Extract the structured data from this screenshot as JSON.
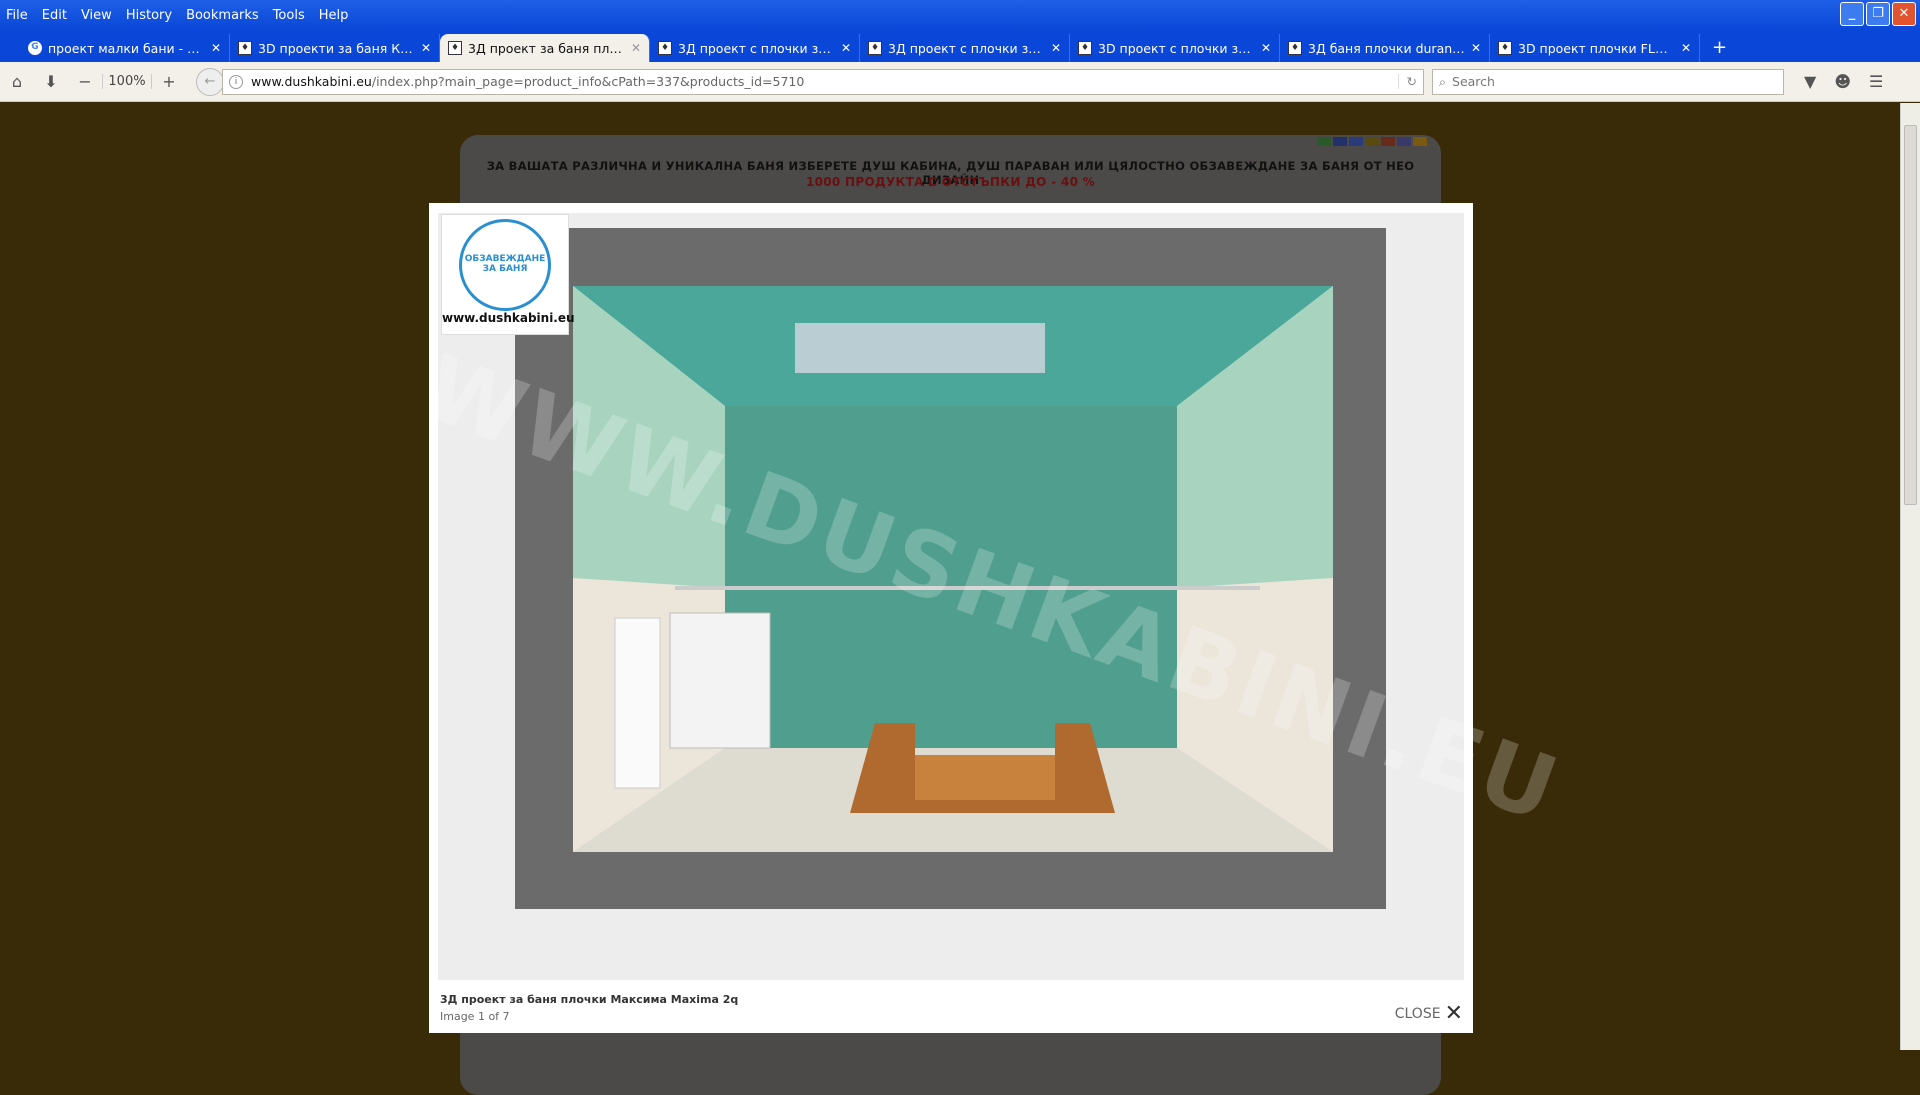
{
  "menu": [
    "File",
    "Edit",
    "View",
    "History",
    "Bookmarks",
    "Tools",
    "Help"
  ],
  "tabs": [
    {
      "label": "проект малки бани - Go...",
      "icon": "google-icon"
    },
    {
      "label": "3D проекти за баня КА...",
      "icon": "site-favicon"
    },
    {
      "label": "3Д проект за баня плоч...",
      "icon": "site-favicon",
      "active": true
    },
    {
      "label": "3Д проект с плочки за ...",
      "icon": "site-favicon"
    },
    {
      "label": "3Д проект с плочки за ...",
      "icon": "site-favicon"
    },
    {
      "label": "3D проект с плочки за ...",
      "icon": "site-favicon"
    },
    {
      "label": "3Д баня плочки durang...",
      "icon": "site-favicon"
    },
    {
      "label": "3D проект плочки FLAM...",
      "icon": "site-favicon"
    }
  ],
  "toolbar": {
    "zoom": "100%",
    "url_domain": "www.dushkabini.eu",
    "url_path": "/index.php?main_page=product_info&cPath=337&products_id=5710",
    "search_placeholder": "Search"
  },
  "page": {
    "slogan": "ЗА ВАШАТА РАЗЛИЧНА И УНИКАЛНА БАНЯ ИЗБЕРЕТЕ ДУШ КАБИНА, ДУШ ПАРАВАН ИЛИ ЦЯЛОСТНО ОБЗАВЕЖДАНЕ ЗА БАНЯ ОТ НЕО ДИЗАЙН",
    "promo": "1000 ПРОДУКТА С ОТСТЪПКИ ДО - 40 %",
    "promo_color": "#c0141a"
  },
  "lightbox": {
    "logo_text": "ОБЗАВЕЖДАНЕ ЗА БАНЯ",
    "logo_site": "www.dushkabini.eu",
    "watermark": "WWW.DUSHKABINI.EU",
    "title": "3Д проект за баня плочки Максима Maxima 2q",
    "counter": "Image 1 of 7",
    "close_label": "CLOSE"
  }
}
